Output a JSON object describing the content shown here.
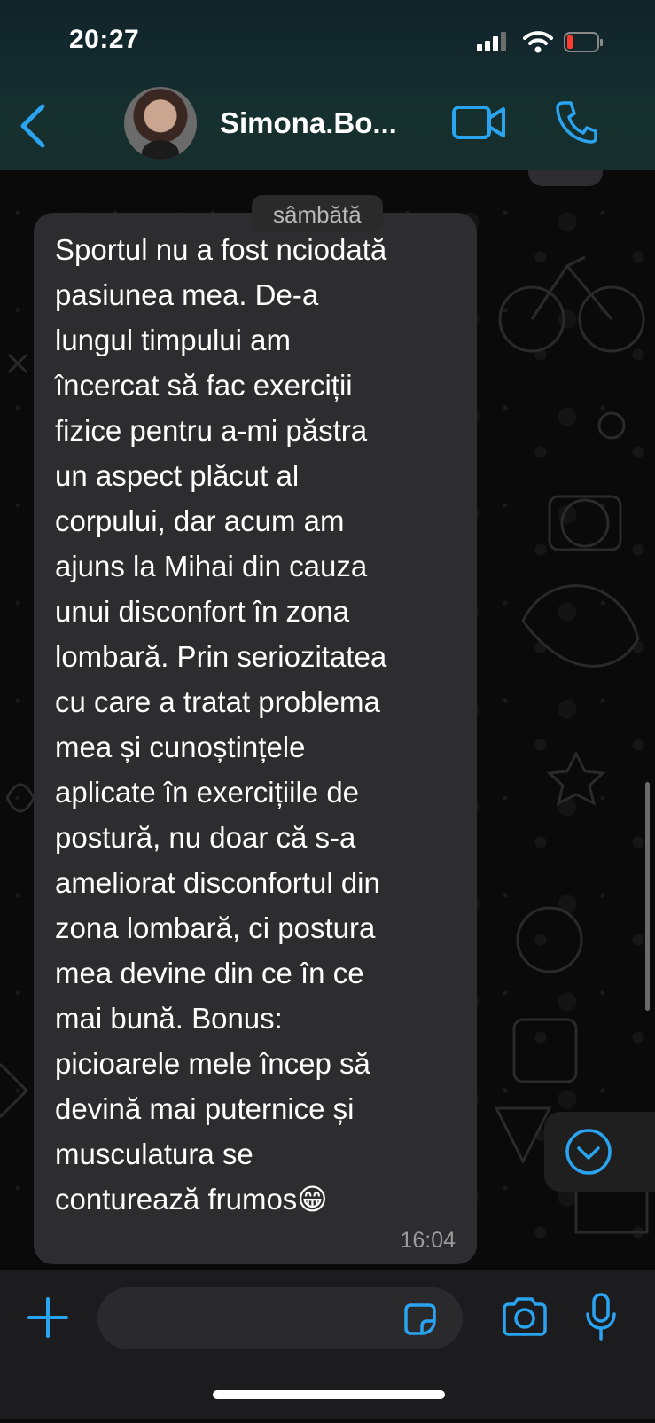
{
  "status_bar": {
    "time": "20:27"
  },
  "header": {
    "contact_name": "Simona.Bo...",
    "icons": [
      "back-chevron-icon",
      "video-call-icon",
      "phone-icon"
    ],
    "accent_color": "#2aa3f0"
  },
  "chat": {
    "date_separator": "sâmbătă",
    "messages": [
      {
        "text": "Sportul nu a fost nciodată\npasiunea mea. De-a\nlungul timpului am\nîncercat să fac exerciții\nfizice pentru a-mi păstra\nun aspect plăcut al\ncorpului, dar acum am\najuns la Mihai din cauza\nunui disconfort în zona\nlombară. Prin seriozitatea\ncu care a tratat problema\nmea și cunoștințele\naplicate în exercițiile de\npostură, nu doar că s-a\nameliorat disconfortul din\nzona lombară, ci postura\nmea devine din ce în ce\nmai bună. Bonus:\npicioarele mele încep să\ndevină mai puternice și\nmusculatura se\nconturează frumos😁",
        "time": "16:04"
      }
    ]
  },
  "input": {
    "placeholder": ""
  }
}
